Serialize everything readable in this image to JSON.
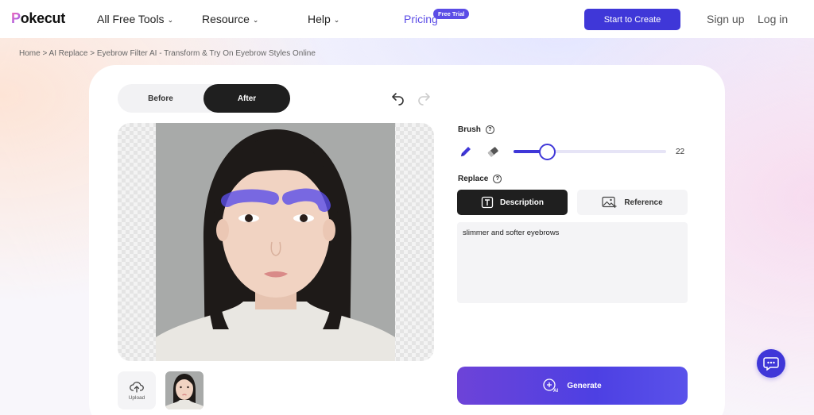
{
  "header": {
    "logo": "okecut",
    "logo_p": "P",
    "nav": {
      "tools": "All Free Tools",
      "resource": "Resource",
      "help": "Help",
      "pricing": "Pricing",
      "pricing_badge": "Free Trial"
    },
    "start_button": "Start to Create",
    "signup": "Sign up",
    "login": "Log in"
  },
  "breadcrumb": "Home > AI Replace > Eyebrow Filter AI - Transform & Try On Eyebrow Styles Online",
  "editor": {
    "before_label": "Before",
    "after_label": "After",
    "upload_label": "Upload"
  },
  "panel": {
    "brush_label": "Brush",
    "brush_size": 22,
    "brush_size_fraction": 0.22,
    "replace_label": "Replace",
    "description_tab": "Description",
    "reference_tab": "Reference",
    "prompt_value": "slimmer and softer eyebrows",
    "generate_label": "Generate"
  },
  "colors": {
    "accent": "#3f37d8",
    "brush_mask": "#5a4ee8"
  }
}
